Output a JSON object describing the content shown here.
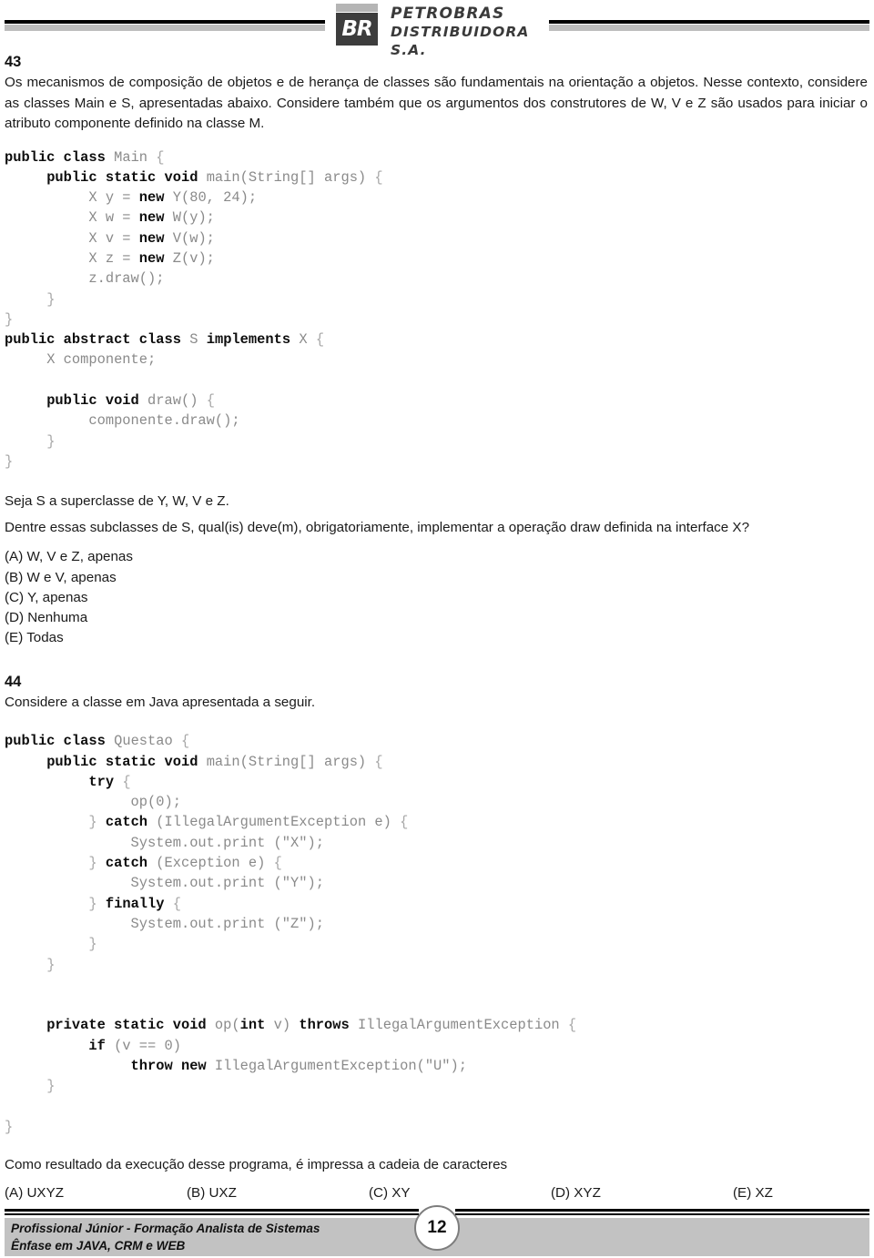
{
  "header": {
    "logo_mark": "BR",
    "brand_line1": "PETROBRAS",
    "brand_line2": "DISTRIBUIDORA S.A."
  },
  "questions": [
    {
      "number": "43",
      "statement": "Os mecanismos de composição de objetos e de herança de classes são fundamentais na orientação a objetos. Nesse contexto, considere as classes Main e S, apresentadas abaixo. Considere também que os argumentos dos construtores de W, V e Z são usados para iniciar o atributo componente definido na classe M.",
      "code_lines": [
        "public class Main {",
        "     public static void main(String[] args) {",
        "          X y = new Y(80, 24);",
        "          X w = new W(y);",
        "          X v = new V(w);",
        "          X z = new Z(v);",
        "          z.draw();",
        "     }",
        "}",
        "public abstract class S implements X {",
        "     X componente;",
        "",
        "     public void draw() {",
        "          componente.draw();",
        "     }",
        "}"
      ],
      "premise": "Seja S a superclasse de Y, W, V e Z.",
      "prompt": "Dentre essas subclasses de S, qual(is) deve(m), obrigatoriamente, implementar a operação draw definida na interface X?",
      "options": [
        "(A) W, V e Z, apenas",
        "(B) W e V, apenas",
        "(C) Y, apenas",
        "(D) Nenhuma",
        "(E) Todas"
      ]
    },
    {
      "number": "44",
      "statement": "Considere a classe em Java apresentada a seguir.",
      "code_lines": [
        "public class Questao {",
        "     public static void main(String[] args) {",
        "          try {",
        "               op(0);",
        "          } catch (IllegalArgumentException e) {",
        "               System.out.print (\"X\");",
        "          } catch (Exception e) {",
        "               System.out.print (\"Y\");",
        "          } finally {",
        "               System.out.print (\"Z\");",
        "          }",
        "     }",
        "",
        "     private static void op(int v) throws IllegalArgumentException {",
        "          if (v == 0)",
        "               throw new IllegalArgumentException(\"U\");",
        "     }",
        "}"
      ],
      "prompt": "Como resultado da execução desse programa, é impressa a cadeia de caracteres",
      "options": [
        "(A) UXYZ",
        "(B) UXZ",
        "(C) XY",
        "(D) XYZ",
        "(E) XZ"
      ]
    }
  ],
  "footer": {
    "line1": "Profissional Júnior - Formação Analista de Sistemas",
    "line2": "Ênfase em JAVA, CRM e WEB",
    "page_number": "12"
  }
}
